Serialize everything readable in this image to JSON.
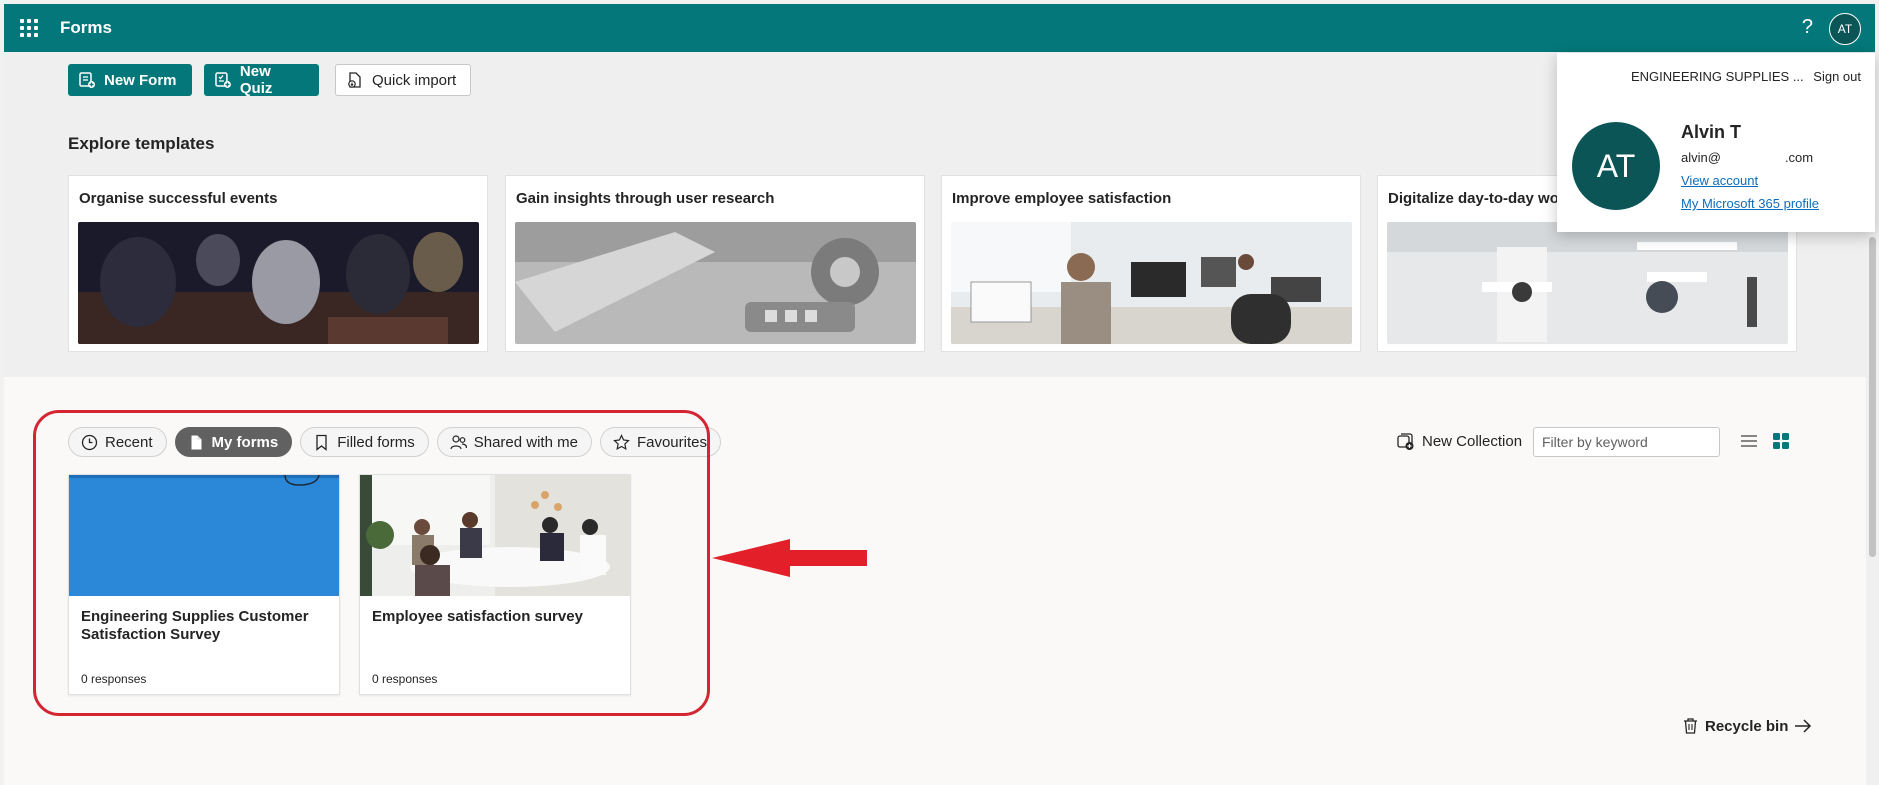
{
  "app": {
    "title": "Forms",
    "help_glyph": "?",
    "user_initials": "AT",
    "accent": "#037779"
  },
  "toolbar": {
    "new_form": "New Form",
    "new_quiz": "New Quiz",
    "quick_import": "Quick import"
  },
  "templates": {
    "title": "Explore templates",
    "items": [
      {
        "label": "Organise successful events"
      },
      {
        "label": "Gain insights through user research"
      },
      {
        "label": "Improve employee satisfaction"
      },
      {
        "label": "Digitalize day-to-day work"
      }
    ]
  },
  "tabs": [
    {
      "label": "Recent",
      "icon": "clock-icon"
    },
    {
      "label": "My forms",
      "icon": "document-icon",
      "selected": true
    },
    {
      "label": "Filled forms",
      "icon": "bookmark-icon"
    },
    {
      "label": "Shared with me",
      "icon": "people-icon"
    },
    {
      "label": "Favourites",
      "icon": "star-icon"
    }
  ],
  "collection": {
    "new_collection": "New Collection",
    "filter_placeholder": "Filter by keyword"
  },
  "forms": [
    {
      "name": "Engineering Supplies Customer Satisfaction Survey",
      "responses": "0 responses"
    },
    {
      "name": "Employee satisfaction survey",
      "responses": "0 responses"
    }
  ],
  "recycle_bin": "Recycle bin",
  "account": {
    "org": "ENGINEERING SUPPLIES ...",
    "sign_out": "Sign out",
    "initials": "AT",
    "name": "Alvin T",
    "email_user": "alvin@",
    "email_domain": ".com",
    "view_account": "View account",
    "profile_link": "My Microsoft 365 profile"
  },
  "annotation": {
    "highlight_color": "#d42533"
  }
}
